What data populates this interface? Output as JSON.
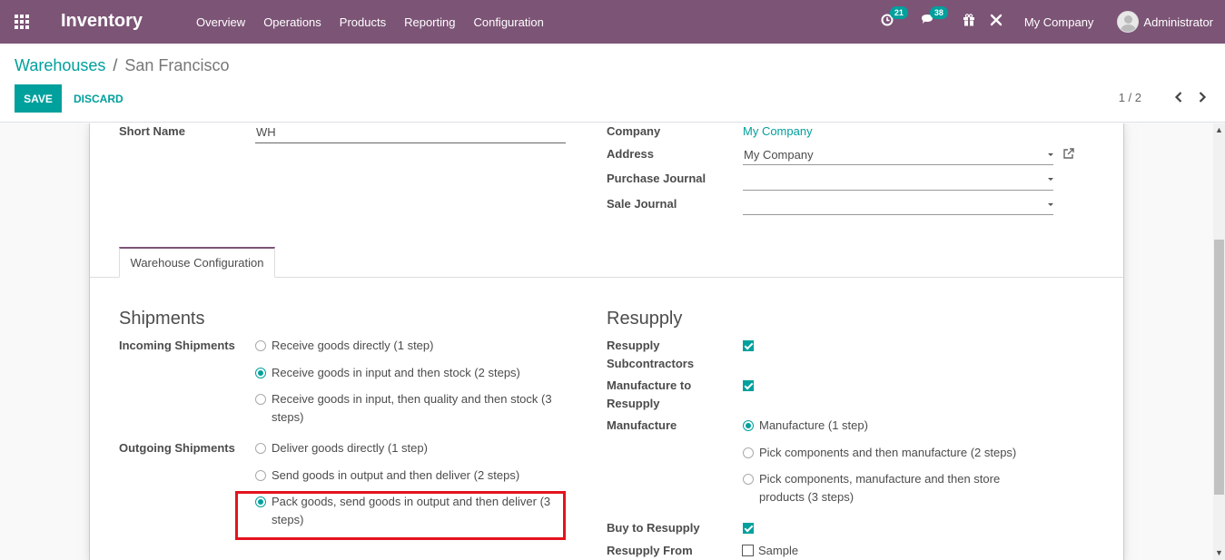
{
  "navbar": {
    "brand": "Inventory",
    "menu": [
      "Overview",
      "Operations",
      "Products",
      "Reporting",
      "Configuration"
    ],
    "activities_count": "21",
    "messages_count": "38",
    "company": "My Company",
    "user": "Administrator"
  },
  "breadcrumb": {
    "parent": "Warehouses",
    "separator": "/",
    "current": "San Francisco"
  },
  "actions": {
    "save": "SAVE",
    "discard": "DISCARD"
  },
  "pager": {
    "value": "1 / 2"
  },
  "header_fields": {
    "short_name_label": "Short Name",
    "short_name_value": "WH",
    "company_label": "Company",
    "company_value": "My Company",
    "address_label": "Address",
    "address_value": "My Company",
    "purchase_journal_label": "Purchase Journal",
    "purchase_journal_value": "",
    "sale_journal_label": "Sale Journal",
    "sale_journal_value": ""
  },
  "tabs": {
    "warehouse_configuration": "Warehouse Configuration"
  },
  "shipments": {
    "title": "Shipments",
    "incoming_label": "Incoming Shipments",
    "incoming_options": [
      {
        "line1": "Receive goods directly (1 step)",
        "line2": "",
        "selected": false
      },
      {
        "line1": "Receive goods in input and then stock (2 steps)",
        "line2": "",
        "selected": true
      },
      {
        "line1": "Receive goods in input, then quality and then stock (3",
        "line2": "steps)",
        "selected": false
      }
    ],
    "outgoing_label": "Outgoing Shipments",
    "outgoing_options": [
      {
        "line1": "Deliver goods directly (1 step)",
        "line2": "",
        "selected": false
      },
      {
        "line1": "Send goods in output and then deliver (2 steps)",
        "line2": "",
        "selected": false
      },
      {
        "line1": "Pack goods, send goods in output and then deliver (3",
        "line2": "steps)",
        "selected": true
      }
    ]
  },
  "resupply": {
    "title": "Resupply",
    "resupply_subcontractors_label_1": "Resupply",
    "resupply_subcontractors_label_2": "Subcontractors",
    "resupply_subcontractors_checked": true,
    "manufacture_to_resupply_label_1": "Manufacture to",
    "manufacture_to_resupply_label_2": "Resupply",
    "manufacture_to_resupply_checked": true,
    "manufacture_label": "Manufacture",
    "manufacture_options": [
      {
        "line1": "Manufacture (1 step)",
        "line2": "",
        "selected": true
      },
      {
        "line1": "Pick components and then manufacture (2 steps)",
        "line2": "",
        "selected": false
      },
      {
        "line1": "Pick components, manufacture and then store",
        "line2": "products (3 steps)",
        "selected": false
      }
    ],
    "buy_to_resupply_label": "Buy to Resupply",
    "buy_to_resupply_checked": true,
    "resupply_from_label": "Resupply From",
    "resupply_from_option": "Sample",
    "resupply_from_checked": false
  },
  "colors": {
    "navbar": "#7c5476",
    "accent": "#00a09d",
    "highlight": "#e3141f"
  }
}
